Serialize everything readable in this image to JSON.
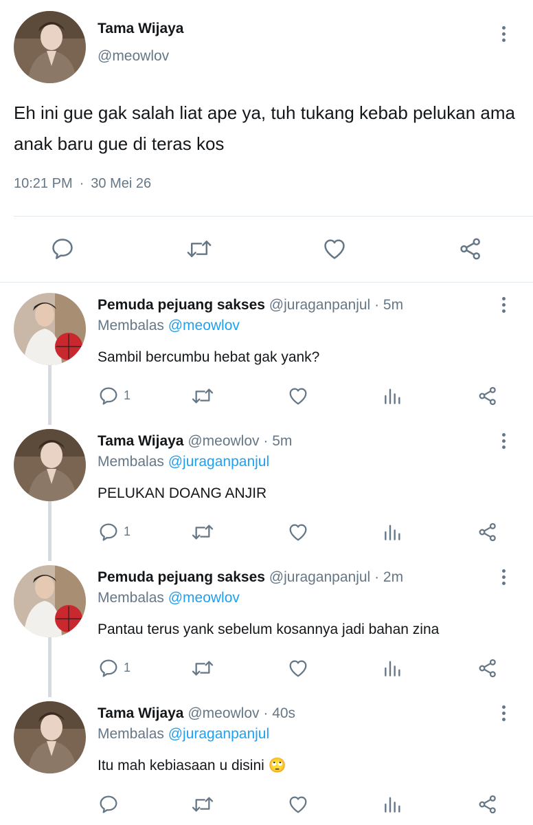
{
  "main_tweet": {
    "author_name": "Tama Wijaya",
    "author_handle": "@meowlov",
    "text": "Eh ini gue gak salah liat ape ya, tuh tukang kebab pelukan ama anak baru gue di teras kos",
    "time": "10:21 PM",
    "separator": "·",
    "date": "30 Mei 26",
    "icons": [
      "comment-icon",
      "retweet-icon",
      "like-icon",
      "share-icon"
    ]
  },
  "replies": [
    {
      "author_name": "Pemuda pejuang sakses",
      "author_handle": "@juraganpanjul",
      "separator": "·",
      "time": "5m",
      "replying_prefix": "Membalas",
      "replying_to": "@meowlov",
      "text": "Sambil bercumbu hebat gak yank?",
      "comment_count": "1"
    },
    {
      "author_name": "Tama Wijaya",
      "author_handle": "@meowlov",
      "separator": "·",
      "time": "5m",
      "replying_prefix": "Membalas",
      "replying_to": "@juraganpanjul",
      "text": "PELUKAN DOANG ANJIR",
      "comment_count": "1"
    },
    {
      "author_name": "Pemuda pejuang sakses",
      "author_handle": "@juraganpanjul",
      "separator": "·",
      "time": "2m",
      "replying_prefix": "Membalas",
      "replying_to": "@meowlov",
      "text": "Pantau terus yank sebelum kosannya jadi bahan zina",
      "comment_count": "1"
    },
    {
      "author_name": "Tama Wijaya",
      "author_handle": "@meowlov",
      "separator": "·",
      "time": "40s",
      "replying_prefix": "Membalas",
      "replying_to": "@juraganpanjul",
      "text": "Itu mah kebiasaan u disini 🙄",
      "comment_count": ""
    }
  ],
  "colors": {
    "link": "#1da1f2",
    "secondary_text": "#657786",
    "primary_text": "#14171a",
    "divider": "#e1e8ed"
  }
}
